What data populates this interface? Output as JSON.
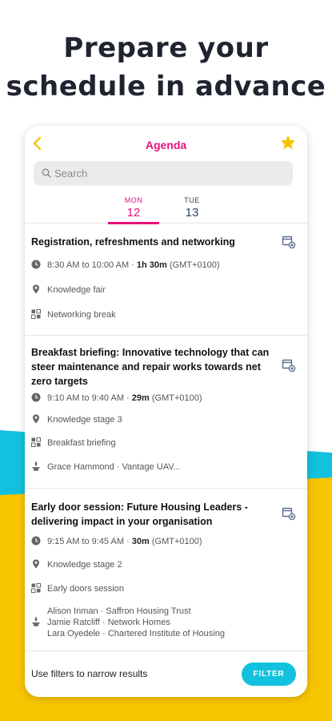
{
  "headline": {
    "line1": "Prepare your",
    "line2": "schedule in advance"
  },
  "colors": {
    "accent_pink": "#e4107c",
    "accent_yellow": "#f5c400",
    "accent_cyan": "#12c1dd",
    "tab_dark": "#2f3f6b"
  },
  "app": {
    "back_icon": "chevron-left-icon",
    "title": "Agenda",
    "favourite_icon": "star-icon",
    "search": {
      "placeholder": "Search",
      "value": ""
    },
    "tabs": [
      {
        "day": "MON",
        "date": "12",
        "active": true
      },
      {
        "day": "TUE",
        "date": "13",
        "active": false
      }
    ]
  },
  "sessions": [
    {
      "title": "Registration, refreshments and networking",
      "time": "8:30 AM to 10:00 AM · ",
      "duration": "1h 30m",
      "tz": " (GMT+0100)",
      "location": "Knowledge fair",
      "type": "Networking break"
    },
    {
      "title": "Breakfast briefing: Innovative technology that can steer maintenance and repair works towards net zero targets",
      "time": "9:10 AM to 9:40 AM · ",
      "duration": "29m",
      "tz": " (GMT+0100)",
      "location": "Knowledge stage 3",
      "type": "Breakfast briefing",
      "speakers": [
        "Grace Hammond · Vantage UAV..."
      ]
    },
    {
      "title": "Early door session: Future Housing Leaders - delivering impact in your organisation",
      "time": "9:15 AM to 9:45 AM · ",
      "duration": "30m",
      "tz": " (GMT+0100)",
      "location": "Knowledge stage 2",
      "type": "Early doors session",
      "speakers": [
        "Alison Inman · Saffron Housing Trust",
        "Jamie Ratcliff · Network Homes",
        "Lara Oyedele · Chartered Institute of Housing"
      ]
    }
  ],
  "footer": {
    "hint": "Use filters to narrow results",
    "filter_label": "FILTER"
  }
}
